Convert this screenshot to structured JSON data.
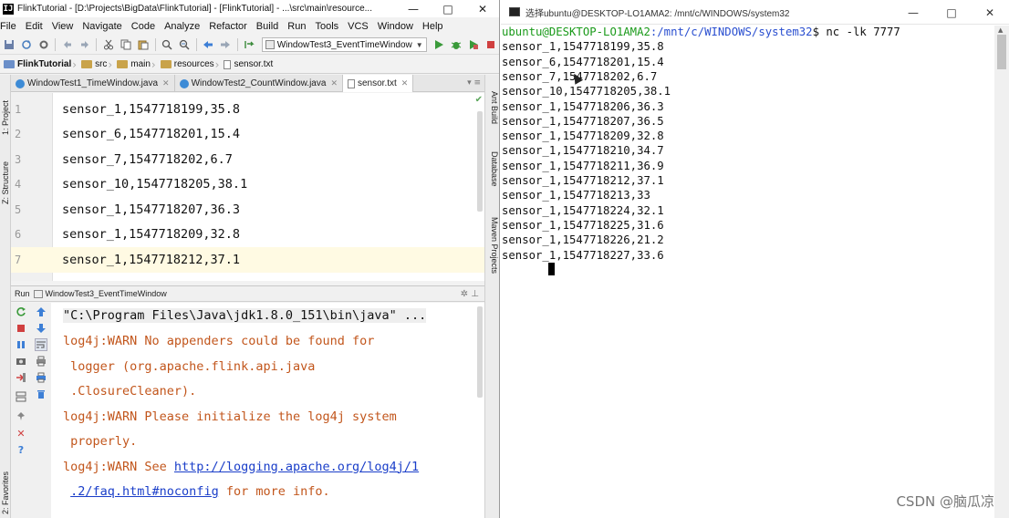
{
  "ide": {
    "title": "FlinkTutorial - [D:\\Projects\\BigData\\FlinkTutorial] - [FlinkTutorial] - ...\\src\\main\\resource...",
    "window_buttons": [
      "—",
      "□",
      "✕"
    ],
    "menu": [
      "File",
      "Edit",
      "View",
      "Navigate",
      "Code",
      "Analyze",
      "Refactor",
      "Build",
      "Run",
      "Tools",
      "VCS",
      "Window",
      "Help"
    ],
    "run_config": "WindowTest3_EventTimeWindow",
    "breadcrumbs": [
      "FlinkTutorial",
      "src",
      "main",
      "resources",
      "sensor.txt"
    ],
    "left_tools": [
      "1: Project",
      "Z: Structure",
      "2: Favorites"
    ],
    "right_tools": [
      "Ant Build",
      "Database",
      "Maven Projects"
    ],
    "tabs": [
      {
        "label": "WindowTest1_TimeWindow.java"
      },
      {
        "label": "WindowTest2_CountWindow.java"
      },
      {
        "label": "sensor.txt"
      }
    ],
    "tab_tail": "▾ ≡",
    "editor_lines": [
      {
        "n": "1",
        "text": "sensor_1,1547718199,35.8"
      },
      {
        "n": "2",
        "text": "sensor_6,1547718201,15.4"
      },
      {
        "n": "3",
        "text": "sensor_7,1547718202,6.7"
      },
      {
        "n": "4",
        "text": "sensor_10,1547718205,38.1"
      },
      {
        "n": "5",
        "text": "sensor_1,1547718207,36.3"
      },
      {
        "n": "6",
        "text": "sensor_1,1547718209,32.8"
      },
      {
        "n": "7",
        "text": "sensor_1,1547718212,37.1"
      }
    ],
    "run_panel": {
      "label": "Run",
      "config": "WindowTest3_EventTimeWindow",
      "tools": "✲ ⊥",
      "console": [
        {
          "text": "\"C:\\Program Files\\Java\\jdk1.8.0_151\\bin\\java\" ...",
          "kind": "cmd"
        },
        {
          "text": "log4j:WARN No appenders could be found for",
          "kind": "warn"
        },
        {
          "text": " logger (org.apache.flink.api.java",
          "kind": "warn"
        },
        {
          "text": " .ClosureCleaner).",
          "kind": "warn"
        },
        {
          "text": "log4j:WARN Please initialize the log4j system",
          "kind": "warn"
        },
        {
          "text": " properly.",
          "kind": "warn"
        }
      ],
      "see_prefix": "log4j:WARN See ",
      "link1": "http://logging.apache.org/log4j/1",
      "link2": ".2/faq.html#noconfig",
      "see_suffix": " for more info."
    }
  },
  "terminal": {
    "title": "选择ubuntu@DESKTOP-LO1AMA2: /mnt/c/WINDOWS/system32",
    "window_buttons": [
      "—",
      "□",
      "✕"
    ],
    "prompt_user": "ubuntu@DESKTOP-LO1AMA2",
    "prompt_path": ":/mnt/c/WINDOWS/system32",
    "prompt_cmd": "$ nc -lk 7777",
    "lines": [
      "sensor_1,1547718199,35.8",
      "sensor_6,1547718201,15.4",
      "sensor_7,1547718202,6.7",
      "sensor_10,1547718205,38.1",
      "sensor_1,1547718206,36.3",
      "sensor_1,1547718207,36.5",
      "sensor_1,1547718209,32.8",
      "sensor_1,1547718210,34.7",
      "sensor_1,1547718211,36.9",
      "sensor_1,1547718212,37.1",
      "sensor_1,1547718213,33",
      "sensor_1,1547718224,32.1",
      "sensor_1,1547718225,31.6",
      "sensor_1,1547718226,21.2",
      "sensor_1,1547718227,33.6"
    ],
    "watermark": "CSDN @脑瓜凉"
  },
  "colors": {
    "warn": "#c2561c",
    "link": "#1a3ec9",
    "prompt_user": "#1a9a1a",
    "prompt_path": "#2a4fd0",
    "current_line": "#fffae3"
  },
  "icons": [
    "app-icon",
    "save-icon",
    "sync-icon",
    "undo-icon",
    "redo-icon",
    "cut-icon",
    "copy-icon",
    "paste-icon",
    "find-icon",
    "replace-icon",
    "back-icon",
    "forward-icon",
    "build-icon",
    "run-icon",
    "debug-icon",
    "coverage-icon",
    "stop-icon",
    "folder-icon",
    "file-icon",
    "rerun-icon",
    "pause-icon",
    "scroll-up-icon",
    "scroll-down-icon",
    "wrap-icon",
    "print-icon",
    "trash-icon",
    "close-icon",
    "help-icon",
    "pin-icon",
    "gear-icon",
    "terminal-icon"
  ]
}
